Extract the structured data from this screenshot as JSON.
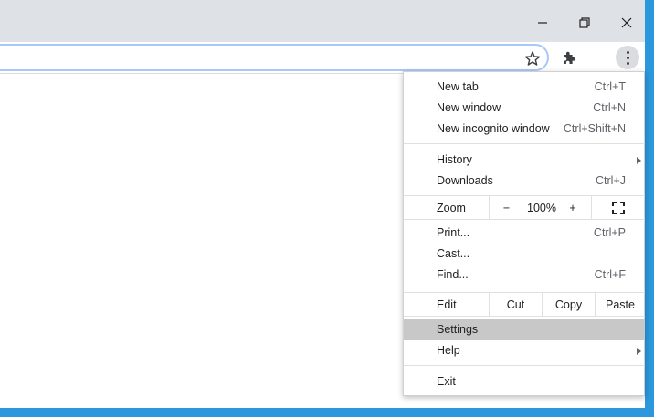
{
  "window_controls": {
    "minimize_icon": "minimize-icon",
    "restore_icon": "restore-icon",
    "close_icon": "close-icon"
  },
  "toolbar": {
    "bookmark_icon": "star-icon",
    "extensions_icon": "puzzle-icon",
    "menu_icon": "kebab-menu-icon"
  },
  "menu": {
    "new_tab": {
      "label": "New tab",
      "shortcut": "Ctrl+T"
    },
    "new_window": {
      "label": "New window",
      "shortcut": "Ctrl+N"
    },
    "new_incognito": {
      "label": "New incognito window",
      "shortcut": "Ctrl+Shift+N"
    },
    "history": {
      "label": "History"
    },
    "downloads": {
      "label": "Downloads",
      "shortcut": "Ctrl+J"
    },
    "zoom": {
      "label": "Zoom",
      "minus": "−",
      "value": "100%",
      "plus": "+"
    },
    "print": {
      "label": "Print...",
      "shortcut": "Ctrl+P"
    },
    "cast": {
      "label": "Cast..."
    },
    "find": {
      "label": "Find...",
      "shortcut": "Ctrl+F"
    },
    "edit": {
      "label": "Edit",
      "cut": "Cut",
      "copy": "Copy",
      "paste": "Paste"
    },
    "settings": {
      "label": "Settings"
    },
    "help": {
      "label": "Help"
    },
    "exit": {
      "label": "Exit"
    }
  },
  "colors": {
    "desktop": "#2b97dc",
    "titlebar": "#dee1e6",
    "highlight": "#c8c8c8"
  }
}
